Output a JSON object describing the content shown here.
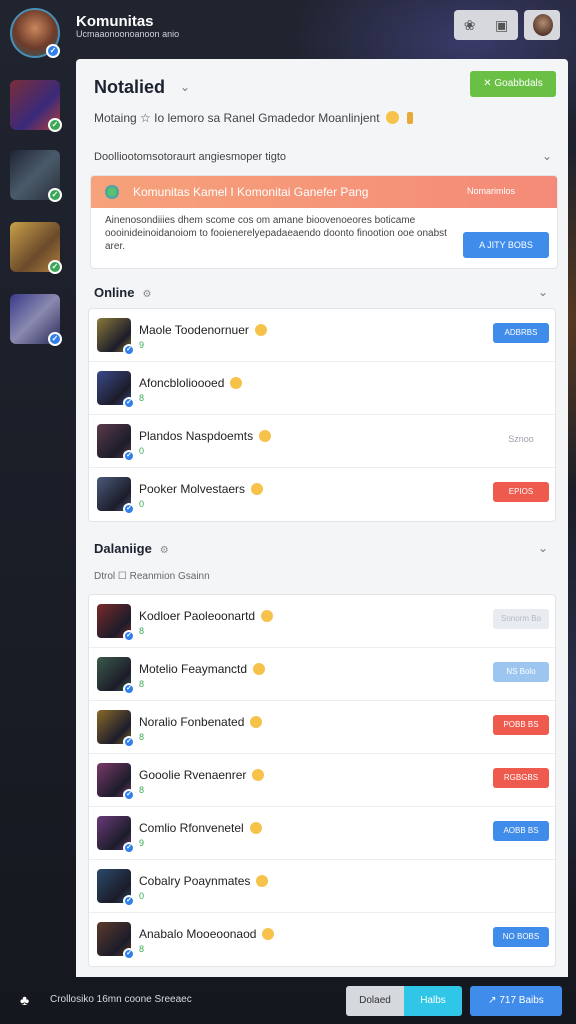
{
  "app": {
    "title": "Komunitas",
    "subtitle": "Ucmaaonoonoanoon anio"
  },
  "header": {
    "icon_left": "leaf-icon",
    "icon_right": "window-icon"
  },
  "panel": {
    "title": "Notalied",
    "green_button": "✕ Goabbdals",
    "subline": "Motaing  ☆    Io  lemoro sa Ranel Gmadedor Moanlinjent",
    "filter": "Doolliootomsotoraurt angiesmoper tigto"
  },
  "promo": {
    "title": "Komunitas Kamel I Komonitai Ganefer Pang",
    "tag": "Nomarimlos",
    "body": "Ainenosondiiies dhem scome cos om amane bioovenoeores boticame oooinideinoidanoiom to fooienerelyepadaeaendo doonto finootion ooe onabst arer.",
    "button": "A JITY BOBS"
  },
  "online": {
    "title": "Online",
    "rows": [
      {
        "name": "Maole Toodenornuer",
        "status": "9",
        "action": "ADBRBS",
        "style": "blue",
        "avatar": "#8a7a3a"
      },
      {
        "name": "Afoncblolioooed",
        "status": "8",
        "action": "",
        "style": "none",
        "avatar": "#3a4a8a"
      },
      {
        "name": "Plandos  Naspdoemts",
        "status": "0",
        "action": "Sznoo",
        "style": "plain",
        "avatar": "#5a3a4a"
      },
      {
        "name": "Pooker  Molvestaers",
        "status": "0",
        "action": "EPIOS",
        "style": "red",
        "avatar": "#4a5a7a"
      }
    ]
  },
  "dalaniige": {
    "title": "Dalaniige",
    "tabs": "Dtrol  ☐  Reanmion Gsainn",
    "rows": [
      {
        "name": "Kodloer Paoleoonartd",
        "status": "8",
        "action": "Sonorm Bo",
        "style": "light",
        "avatar": "#7a2a2a"
      },
      {
        "name": "Motelio Feaymanctd",
        "status": "8",
        "action": "NS Bolo",
        "style": "lightblue",
        "avatar": "#3a5a4a"
      },
      {
        "name": "Noralio Fonbenated",
        "status": "8",
        "action": "POBB BS",
        "style": "red",
        "avatar": "#8a6a2a"
      },
      {
        "name": "Gooolie Rvenaenrer",
        "status": "8",
        "action": "RGBGBS",
        "style": "red",
        "avatar": "#7a3a6a"
      },
      {
        "name": "Comlio Rfonvenetel",
        "status": "9",
        "action": "AOBB BS",
        "style": "blue",
        "avatar": "#6a3a7a"
      },
      {
        "name": "Cobalry Poaynmates",
        "status": "0",
        "action": "",
        "style": "none",
        "avatar": "#2a4a6a"
      },
      {
        "name": "Anabalo Mooeoonaod",
        "status": "8",
        "action": "NO BOBS",
        "style": "blue",
        "avatar": "#5a3a2a"
      }
    ]
  },
  "footer": {
    "text": "Crollosiko 16mn coone Sreeaec",
    "segment_a": "Dolaed",
    "segment_b": "Halbs",
    "button": "↗ 717 Baibs"
  },
  "colors": {
    "primary": "#3f8ceb",
    "success": "#6ac044",
    "danger": "#ef5a4e",
    "promo": "#f48a78"
  }
}
